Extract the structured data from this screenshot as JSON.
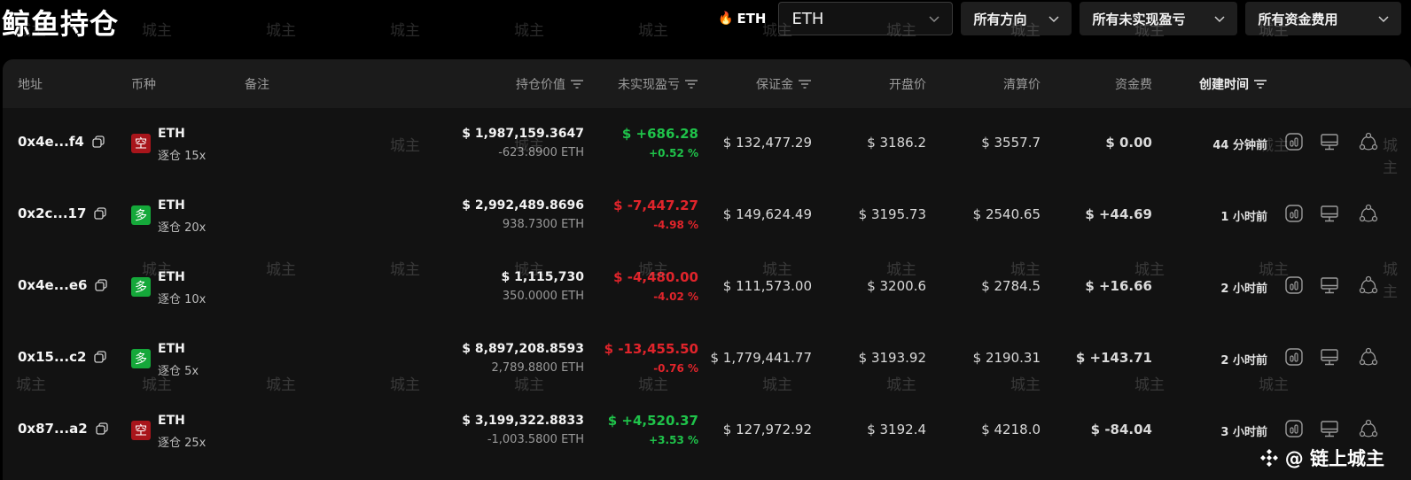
{
  "page": {
    "title": "鲸鱼持仓",
    "asset_tag": "ETH",
    "filters": {
      "coin_select": "ETH",
      "direction": "所有方向",
      "pnl": "所有未实现盈亏",
      "funding": "所有资金费用"
    }
  },
  "table": {
    "headers": {
      "address": "地址",
      "coin": "币种",
      "note": "备注",
      "value": "持仓价值",
      "pnl": "未实现盈亏",
      "margin": "保证金",
      "open": "开盘价",
      "liq": "清算价",
      "funding": "资金费",
      "created": "创建时间"
    },
    "rows": [
      {
        "address": "0x4e...f4",
        "side": "空",
        "side_type": "short",
        "coin": "ETH",
        "lev": "逐仓 15x",
        "value": "$ 1,987,159.3647",
        "qty": "-623.8900 ETH",
        "pnl": "$ +686.28",
        "pnl_pct": "+0.52 %",
        "pnl_sign": "pos",
        "margin": "$ 132,477.29",
        "open": "$ 3186.2",
        "liq": "$ 3557.7",
        "funding": "$ 0.00",
        "funding_sign": "zero",
        "created": "44 分钟前"
      },
      {
        "address": "0x2c...17",
        "side": "多",
        "side_type": "long",
        "coin": "ETH",
        "lev": "逐仓 20x",
        "value": "$ 2,992,489.8696",
        "qty": "938.7300 ETH",
        "pnl": "$ -7,447.27",
        "pnl_pct": "-4.98 %",
        "pnl_sign": "neg",
        "margin": "$ 149,624.49",
        "open": "$ 3195.73",
        "liq": "$ 2540.65",
        "funding": "$ +44.69",
        "funding_sign": "pos",
        "created": "1 小时前"
      },
      {
        "address": "0x4e...e6",
        "side": "多",
        "side_type": "long",
        "coin": "ETH",
        "lev": "逐仓 10x",
        "value": "$ 1,115,730",
        "qty": "350.0000 ETH",
        "pnl": "$ -4,480.00",
        "pnl_pct": "-4.02 %",
        "pnl_sign": "neg",
        "margin": "$ 111,573.00",
        "open": "$ 3200.6",
        "liq": "$ 2784.5",
        "funding": "$ +16.66",
        "funding_sign": "pos",
        "created": "2 小时前"
      },
      {
        "address": "0x15...c2",
        "side": "多",
        "side_type": "long",
        "coin": "ETH",
        "lev": "逐仓 5x",
        "value": "$ 8,897,208.8593",
        "qty": "2,789.8800 ETH",
        "pnl": "$ -13,455.50",
        "pnl_pct": "-0.76 %",
        "pnl_sign": "neg",
        "margin": "$ 1,779,441.77",
        "open": "$ 3193.92",
        "liq": "$ 2190.31",
        "funding": "$ +143.71",
        "funding_sign": "pos",
        "created": "2 小时前"
      },
      {
        "address": "0x87...a2",
        "side": "空",
        "side_type": "short",
        "coin": "ETH",
        "lev": "逐仓 25x",
        "value": "$ 3,199,322.8833",
        "qty": "-1,003.5800 ETH",
        "pnl": "$ +4,520.37",
        "pnl_pct": "+3.53 %",
        "pnl_sign": "pos",
        "margin": "$ 127,972.92",
        "open": "$ 3192.4",
        "liq": "$ 4218.0",
        "funding": "$ -84.04",
        "funding_sign": "neg",
        "created": "3 小时前"
      }
    ]
  },
  "watermark": "城主",
  "brand": "@ 链上城主",
  "colors": {
    "positive": "#1fc34a",
    "negative": "#e0242b",
    "short_badge": "#a8151b",
    "long_badge": "#15a83a"
  },
  "icons": {
    "row_actions": [
      "chart-icon",
      "monitor-icon",
      "share-icon"
    ],
    "copy": "copy-icon",
    "sort": "sort-icon",
    "chevron": "chevron-down-icon",
    "fire": "fire-icon"
  }
}
